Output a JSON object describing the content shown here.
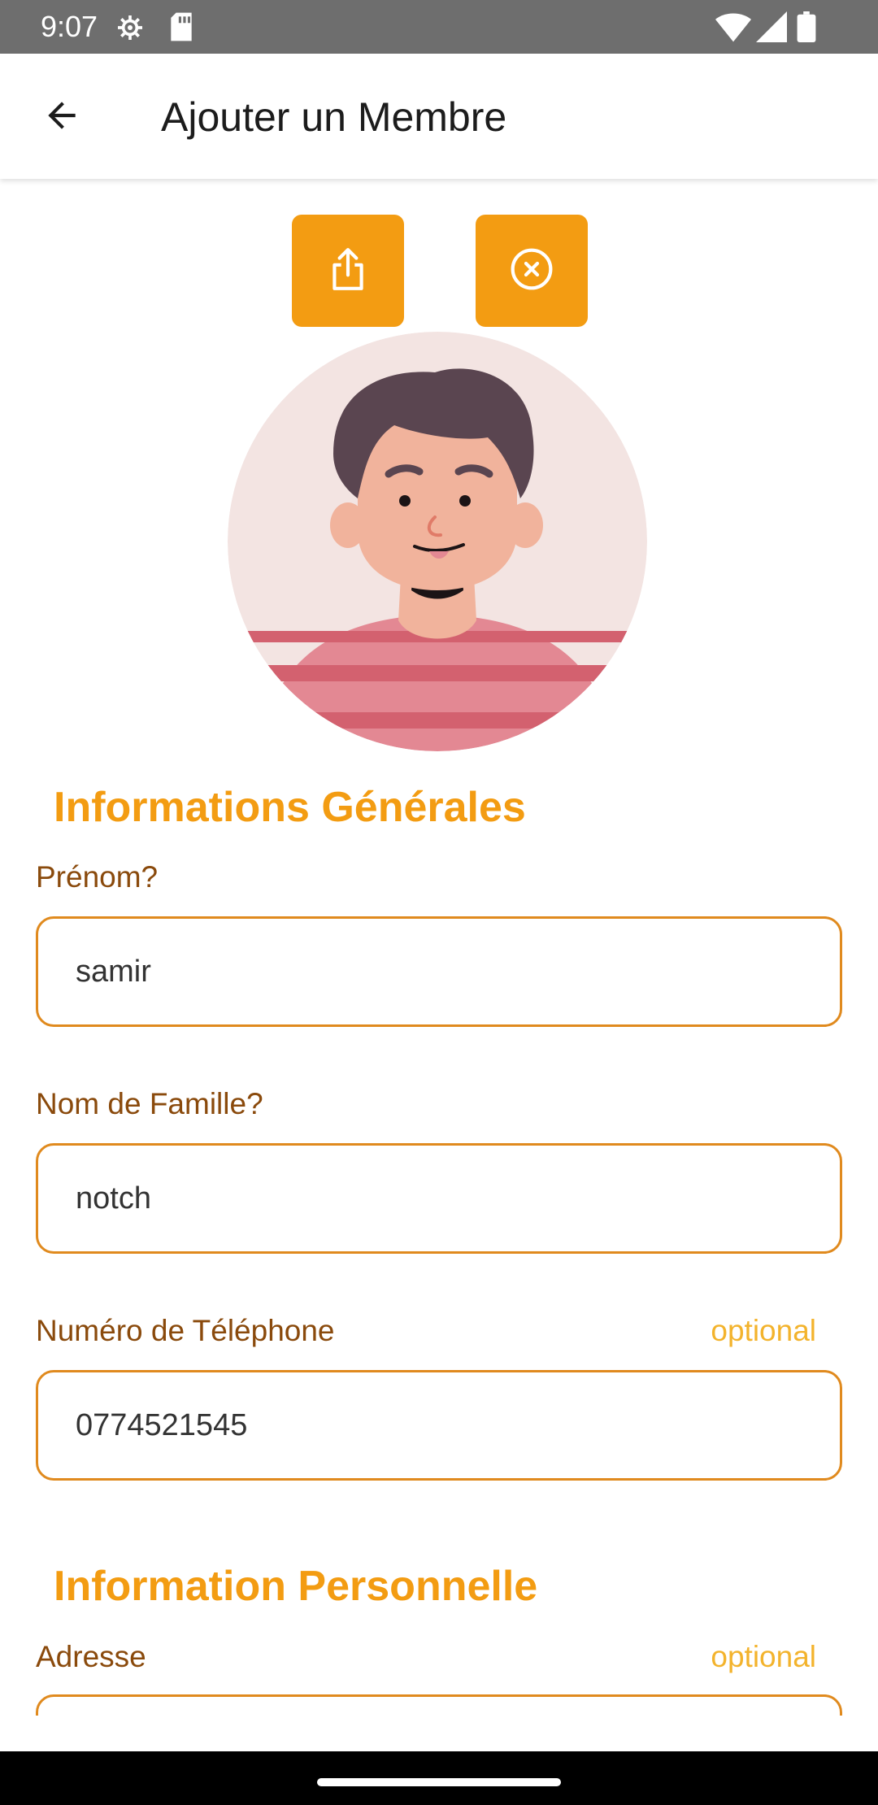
{
  "status_bar": {
    "time": "9:07",
    "icons": [
      "settings-gear-icon",
      "sd-card-icon",
      "wifi-icon",
      "signal-icon",
      "battery-icon"
    ]
  },
  "app_bar": {
    "back_icon": "arrow-left-icon",
    "title": "Ajouter un Membre"
  },
  "actions": {
    "upload_icon": "share-upload-icon",
    "remove_icon": "close-circle-icon",
    "accent_color": "#f39c12"
  },
  "avatar": {
    "icon": "person-avatar-illustration"
  },
  "sections": {
    "general_title": "Informations Générales",
    "personal_title": "Information Personnelle"
  },
  "fields": {
    "first_name": {
      "label": "Prénom?",
      "value": "samir"
    },
    "last_name": {
      "label": "Nom de Famille?",
      "value": "notch"
    },
    "phone": {
      "label": "Numéro de Téléphone",
      "optional": "optional",
      "value": "0774521545"
    },
    "address": {
      "label": "Adresse",
      "optional": "optional",
      "value": ""
    }
  },
  "colors": {
    "accent": "#f39c12",
    "label": "#8a4a0c",
    "optional": "#f3b32c",
    "field_border": "#e08a1e"
  }
}
